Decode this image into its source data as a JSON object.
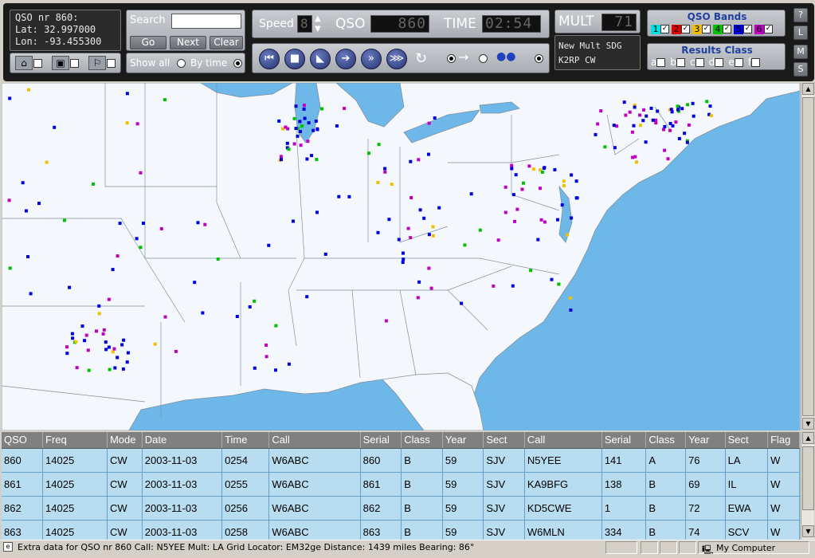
{
  "info": {
    "qso_line": "QSO nr 860:",
    "lat_line": "Lat: 32.997000",
    "lon_line": "Lon: -93.455300"
  },
  "search": {
    "label": "Search",
    "value": "",
    "go": "Go",
    "next": "Next",
    "clear": "Clear",
    "show_all": "Show all",
    "by_time": "By time"
  },
  "playback": {
    "speed_label": "Speed",
    "speed_value": "8",
    "qso_label": "QSO",
    "qso_value": "860",
    "time_label": "TIME",
    "time_value": "02:54"
  },
  "mult": {
    "label": "MULT",
    "value": "71",
    "new_mult_line": "New Mult SDG",
    "call_line": "K2RP   CW"
  },
  "bands": {
    "title": "QSO Bands",
    "items": [
      {
        "num": "1",
        "color": "#00e0e0"
      },
      {
        "num": "2",
        "color": "#e00000"
      },
      {
        "num": "3",
        "color": "#f0c000"
      },
      {
        "num": "4",
        "color": "#00c000"
      },
      {
        "num": "5",
        "color": "#0000e0"
      },
      {
        "num": "6",
        "color": "#c000c0"
      }
    ]
  },
  "results_class": {
    "title": "Results Class",
    "items": [
      "a",
      "b",
      "c",
      "d",
      "e",
      "f"
    ]
  },
  "side_buttons": [
    "?",
    "L",
    "M",
    "S"
  ],
  "table": {
    "headers": [
      "QSO",
      "Freq",
      "Mode",
      "Date",
      "Time",
      "Call",
      "Serial",
      "Class",
      "Year",
      "Sect",
      "Call",
      "Serial",
      "Class",
      "Year",
      "Sect",
      "Flag"
    ],
    "rows": [
      [
        "860",
        "14025",
        "CW",
        "2003-11-03",
        "0254",
        "W6ABC",
        "860",
        "B",
        "59",
        "SJV",
        "N5YEE",
        "141",
        "A",
        "76",
        "LA",
        "W"
      ],
      [
        "861",
        "14025",
        "CW",
        "2003-11-03",
        "0255",
        "W6ABC",
        "861",
        "B",
        "59",
        "SJV",
        "KA9BFG",
        "138",
        "B",
        "69",
        "IL",
        "W"
      ],
      [
        "862",
        "14025",
        "CW",
        "2003-11-03",
        "0256",
        "W6ABC",
        "862",
        "B",
        "59",
        "SJV",
        "KD5CWE",
        "1",
        "B",
        "72",
        "EWA",
        "W"
      ],
      [
        "863",
        "14025",
        "CW",
        "2003-11-03",
        "0258",
        "W6ABC",
        "863",
        "B",
        "59",
        "SJV",
        "W6MLN",
        "334",
        "B",
        "74",
        "SCV",
        "W"
      ]
    ]
  },
  "status": {
    "text": "Extra data for QSO nr 860  Call: N5YEE   Mult: LA  Grid Locator: EM32ge  Distance: 1439 miles  Bearing: 86°",
    "computer": "My Computer"
  },
  "map_colors": {
    "water": "#6db8e8",
    "land": "#f4f8fc",
    "border": "#8090a0"
  }
}
